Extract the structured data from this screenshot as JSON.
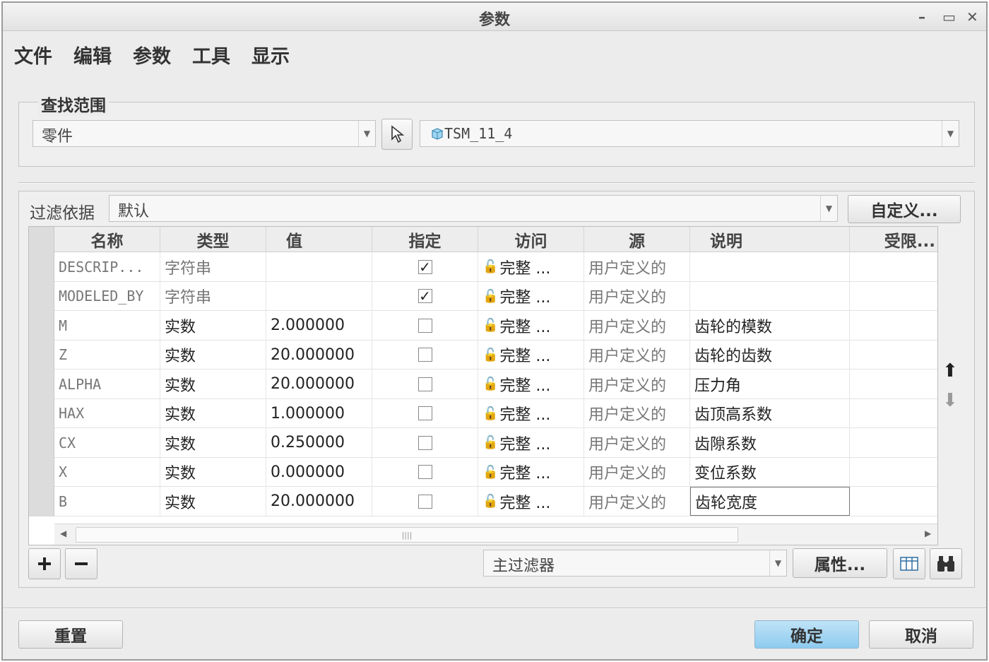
{
  "window": {
    "title": "参数"
  },
  "menu": [
    "文件",
    "编辑",
    "参数",
    "工具",
    "显示"
  ],
  "scope": {
    "label": "查找范围",
    "type_value": "零件",
    "model_value": "TSM_11_4"
  },
  "filter": {
    "label": "过滤依据",
    "value": "默认",
    "customize_label": "自定义..."
  },
  "table": {
    "columns": [
      "名称",
      "类型",
      "值",
      "指定",
      "访问",
      "源",
      "说明",
      "受限..."
    ],
    "rows": [
      {
        "name": "DESCRIP...",
        "type": "字符串",
        "value": "",
        "designated": true,
        "access": "完整 ...",
        "source": "用户定义的",
        "description": ""
      },
      {
        "name": "MODELED_BY",
        "type": "字符串",
        "value": "",
        "designated": true,
        "access": "完整 ...",
        "source": "用户定义的",
        "description": ""
      },
      {
        "name": "M",
        "type": "实数",
        "value": "2.000000",
        "designated": false,
        "access": "完整 ...",
        "source": "用户定义的",
        "description": "齿轮的模数"
      },
      {
        "name": "Z",
        "type": "实数",
        "value": "20.000000",
        "designated": false,
        "access": "完整 ...",
        "source": "用户定义的",
        "description": "齿轮的齿数"
      },
      {
        "name": "ALPHA",
        "type": "实数",
        "value": "20.000000",
        "designated": false,
        "access": "完整 ...",
        "source": "用户定义的",
        "description": "压力角"
      },
      {
        "name": "HAX",
        "type": "实数",
        "value": "1.000000",
        "designated": false,
        "access": "完整 ...",
        "source": "用户定义的",
        "description": "齿顶高系数"
      },
      {
        "name": "CX",
        "type": "实数",
        "value": "0.250000",
        "designated": false,
        "access": "完整 ...",
        "source": "用户定义的",
        "description": "齿隙系数"
      },
      {
        "name": "X",
        "type": "实数",
        "value": "0.000000",
        "designated": false,
        "access": "完整 ...",
        "source": "用户定义的",
        "description": "变位系数"
      },
      {
        "name": "B",
        "type": "实数",
        "value": "20.000000",
        "designated": false,
        "access": "完整 ...",
        "source": "用户定义的",
        "description": "齿轮宽度"
      }
    ]
  },
  "bottom": {
    "main_filter_value": "主过滤器",
    "properties_label": "属性..."
  },
  "footer": {
    "reset_label": "重置",
    "ok_label": "确定",
    "cancel_label": "取消"
  },
  "colors": {
    "ok_button": "#9fd3f2",
    "window_bg": "#ececec"
  }
}
